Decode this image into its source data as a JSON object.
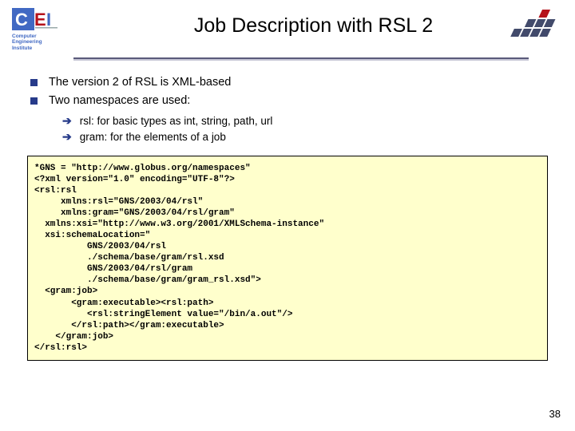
{
  "logo": {
    "line1": "Computer",
    "line2": "Engineering",
    "line3": "Institute"
  },
  "title": "Job Description with RSL 2",
  "bullets": [
    "The version 2 of RSL is XML-based",
    "Two namespaces are used:"
  ],
  "subbullets": [
    "rsl: for basic types as int, string, path, url",
    "gram: for the elements of a job"
  ],
  "code": "*GNS = \"http://www.globus.org/namespaces\"\n<?xml version=\"1.0\" encoding=\"UTF-8\"?>\n<rsl:rsl\n     xmlns:rsl=\"GNS/2003/04/rsl\"\n     xmlns:gram=\"GNS/2003/04/rsl/gram\"\n  xmlns:xsi=\"http://www.w3.org/2001/XMLSchema-instance\"\n  xsi:schemaLocation=\"\n          GNS/2003/04/rsl\n          ./schema/base/gram/rsl.xsd\n          GNS/2003/04/rsl/gram\n          ./schema/base/gram/gram_rsl.xsd\">\n  <gram:job>\n       <gram:executable><rsl:path>\n          <rsl:stringElement value=\"/bin/a.out\"/>\n       </rsl:path></gram:executable>\n    </gram:job>\n</rsl:rsl>",
  "pagenum": "38"
}
